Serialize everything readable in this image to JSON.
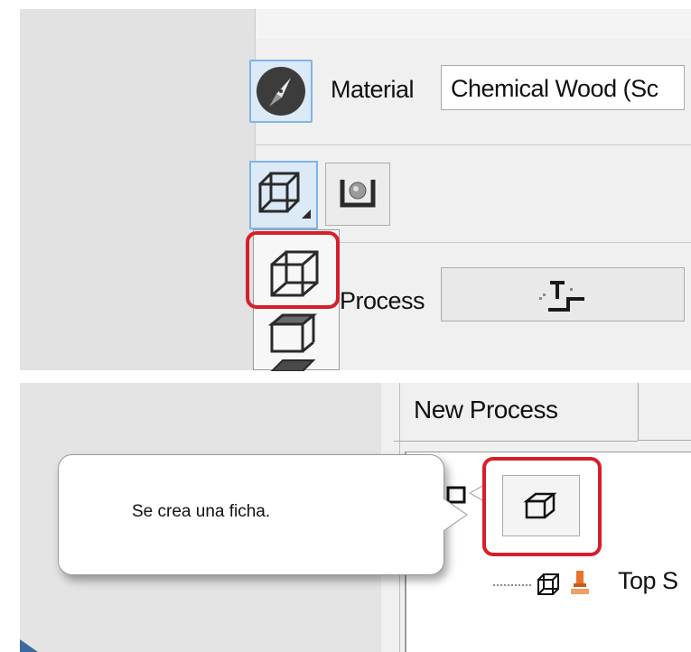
{
  "top_panel": {
    "material_label": "Material",
    "material_value": "Chemical Wood (Sc",
    "process_label": "Process"
  },
  "bottom_panel": {
    "tab_title": "New Process",
    "tree_item_label": "Top S"
  },
  "callout": {
    "text": "Se crea una ficha."
  },
  "colors": {
    "highlight": "#d71f29",
    "selected_button_border": "#7eb4ea",
    "selected_button_fill": "#dce9f7"
  },
  "icons": {
    "material": "compass-sphere-icon",
    "stock_box": "wireframe-box-icon",
    "stock_cylinder": "cylinder-stock-icon",
    "process": "toolpath-step-icon",
    "tree_process": "machining-tool-icon"
  }
}
